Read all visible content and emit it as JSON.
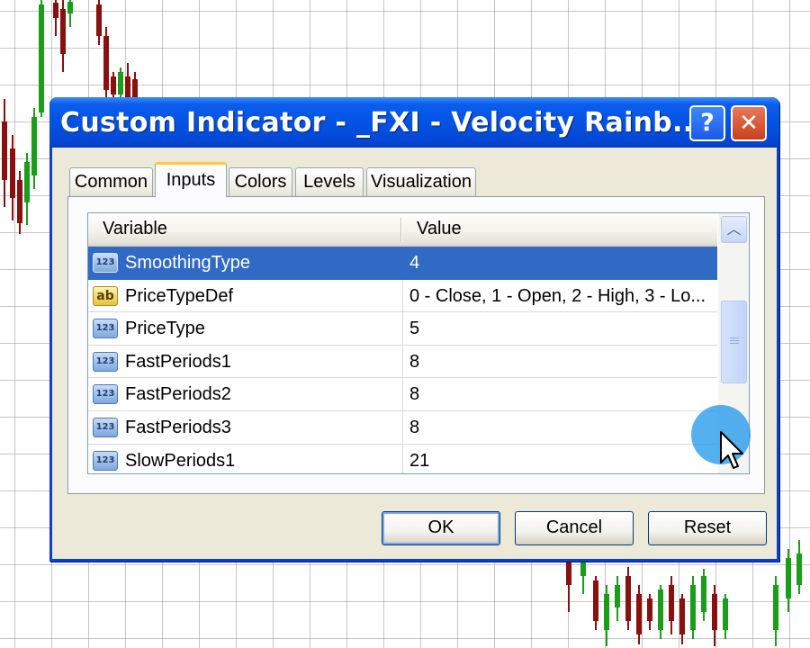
{
  "colors": {
    "bull_candle": "#1a9e1a",
    "bear_candle": "#8a1010",
    "title_bar": "#0553e3",
    "selection": "#316ac5",
    "cursor_highlight": "#1c96eb"
  },
  "dialog": {
    "title": "Custom Indicator - _FXI - Velocity Rainb...",
    "help_label": "?",
    "close_label": "✕"
  },
  "tabs": [
    {
      "label": "Common",
      "active": false
    },
    {
      "label": "Inputs",
      "active": true
    },
    {
      "label": "Colors",
      "active": false
    },
    {
      "label": "Levels",
      "active": false
    },
    {
      "label": "Visualization",
      "active": false
    }
  ],
  "grid": {
    "headers": {
      "variable": "Variable",
      "value": "Value"
    },
    "rows": [
      {
        "icon": "integer-type-icon",
        "icon_text": "123",
        "name": "SmoothingType",
        "value": "4",
        "selected": true
      },
      {
        "icon": "string-type-icon",
        "icon_text": "ab",
        "name": "PriceTypeDef",
        "value": "0 - Close, 1 - Open, 2 - High, 3 - Lo...",
        "selected": false
      },
      {
        "icon": "integer-type-icon",
        "icon_text": "123",
        "name": "PriceType",
        "value": "5",
        "selected": false
      },
      {
        "icon": "integer-type-icon",
        "icon_text": "123",
        "name": "FastPeriods1",
        "value": "8",
        "selected": false
      },
      {
        "icon": "integer-type-icon",
        "icon_text": "123",
        "name": "FastPeriods2",
        "value": "8",
        "selected": false
      },
      {
        "icon": "integer-type-icon",
        "icon_text": "123",
        "name": "FastPeriods3",
        "value": "8",
        "selected": false
      },
      {
        "icon": "integer-type-icon",
        "icon_text": "123",
        "name": "SlowPeriods1",
        "value": "21",
        "selected": false
      }
    ]
  },
  "buttons": {
    "ok": "OK",
    "cancel": "Cancel",
    "reset": "Reset"
  }
}
